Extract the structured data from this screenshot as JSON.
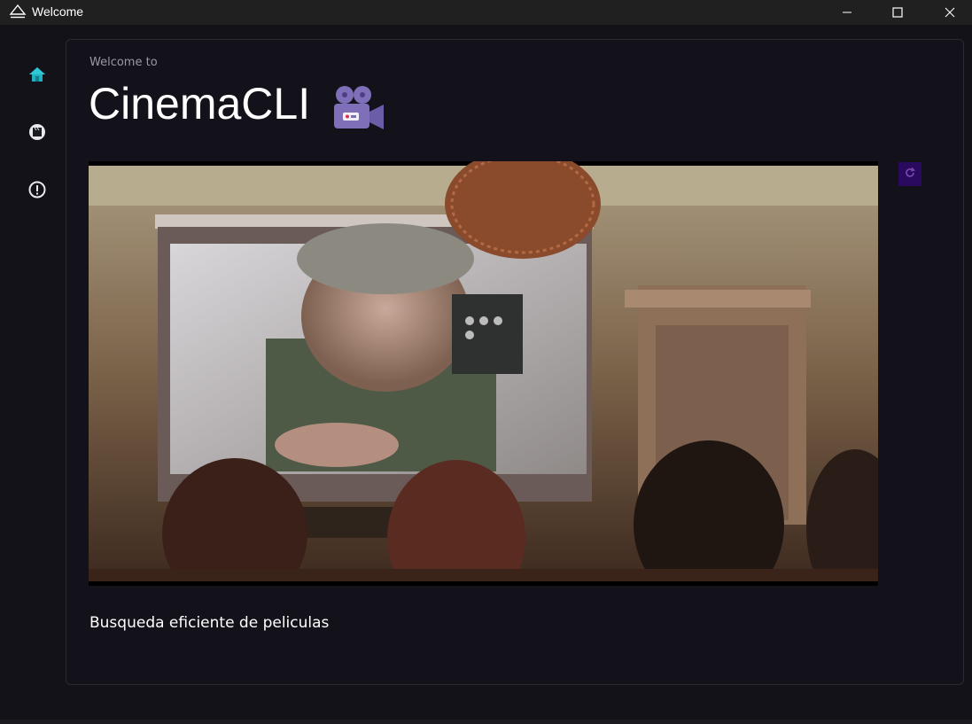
{
  "window": {
    "title": "Welcome",
    "controls": [
      "minimize-icon",
      "maximize-icon",
      "close-icon"
    ]
  },
  "sidebar": {
    "items": [
      {
        "name": "home",
        "icon": "home-icon",
        "active": true,
        "color": "#21b0c0"
      },
      {
        "name": "movies",
        "icon": "clapperboard-icon",
        "active": false
      },
      {
        "name": "about",
        "icon": "alert-icon",
        "active": false
      }
    ]
  },
  "main": {
    "welcome_text": "Welcome to",
    "app_title": "CinemaCLI",
    "title_icon": "movie-camera-icon",
    "image": "cinema-screening-photo",
    "refresh_icon": "refresh-icon",
    "tagline": "Busqueda eficiente de peliculas"
  },
  "colors": {
    "background": "#131218",
    "accent": "#21b0c0",
    "refresh_button": "#2a0a5e"
  }
}
